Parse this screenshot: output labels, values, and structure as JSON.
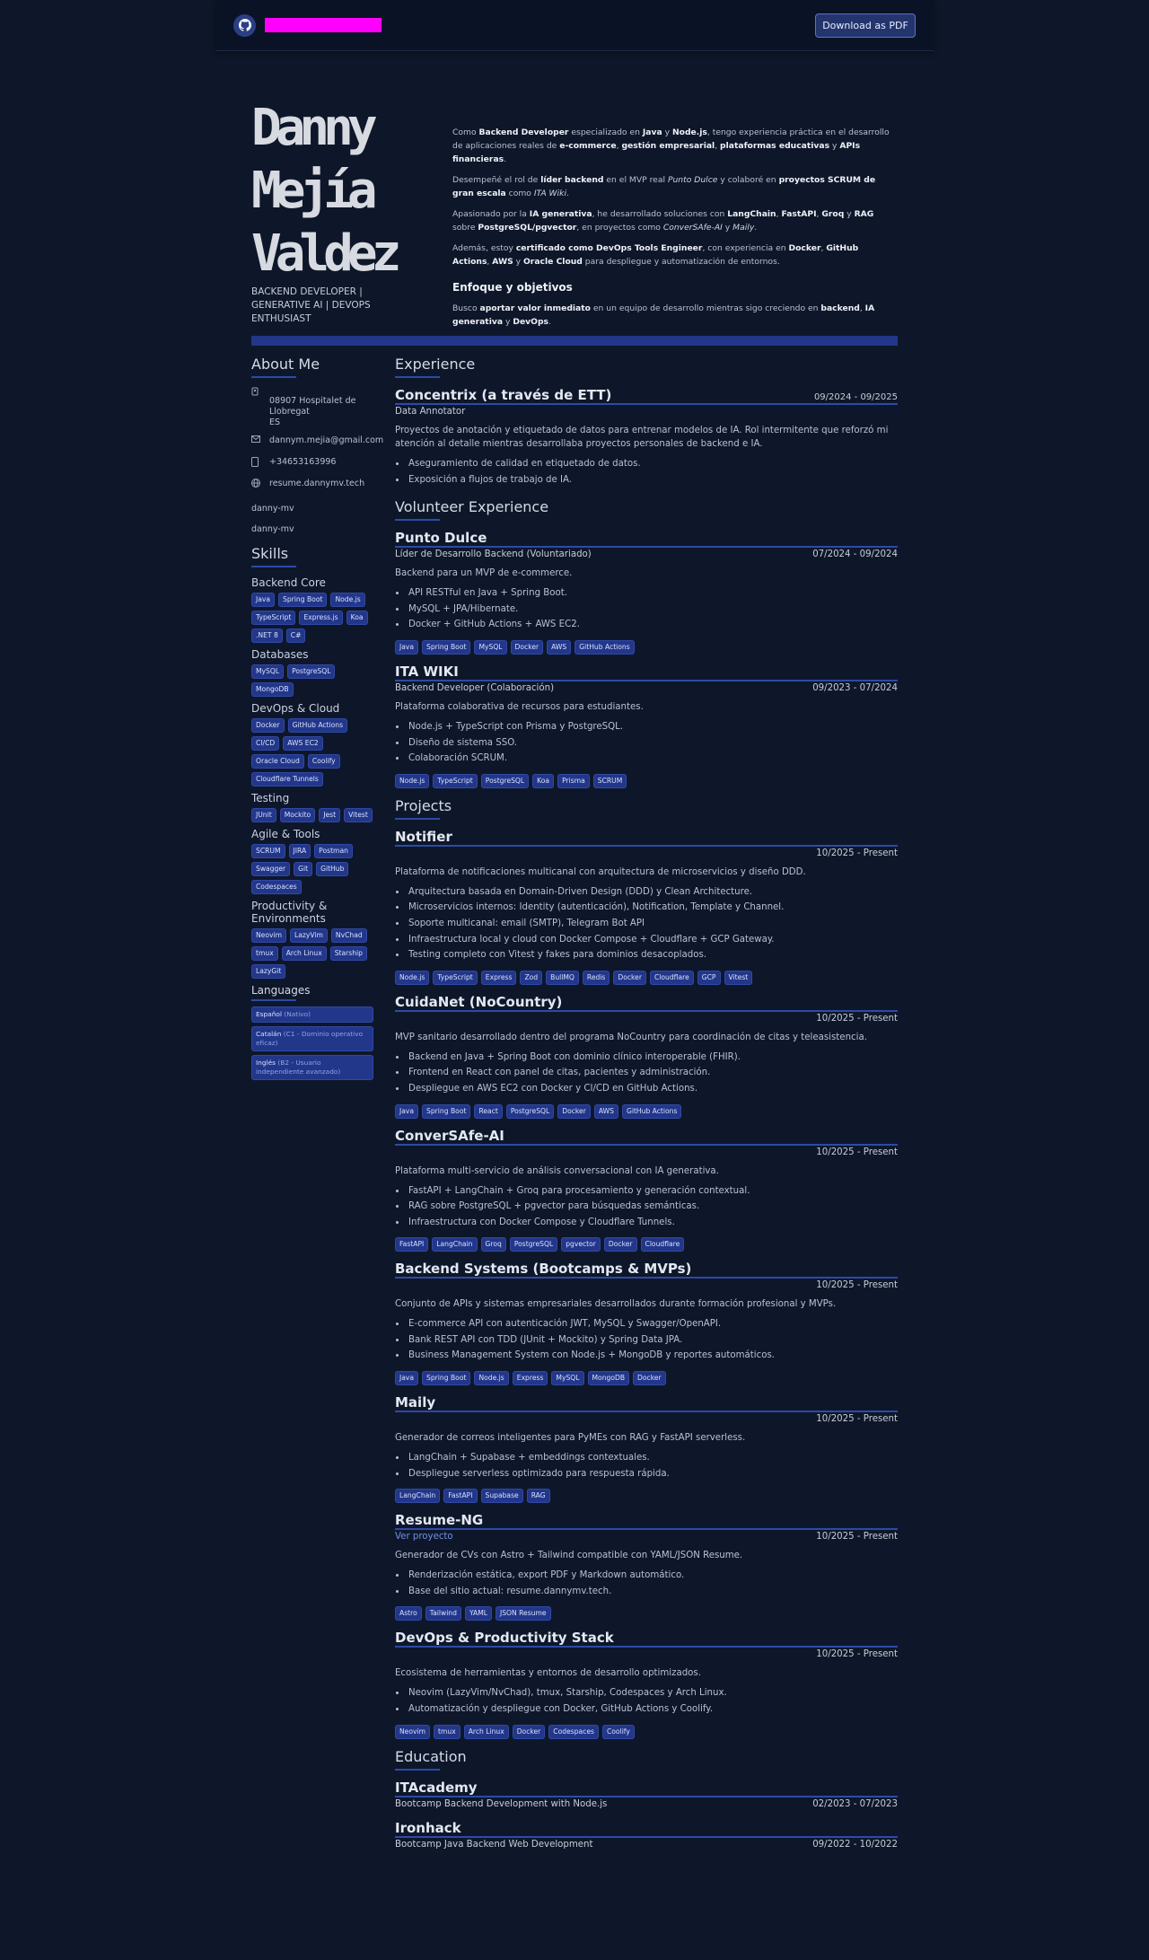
{
  "topbar": {
    "github_icon": "github-icon",
    "download_label": "Download as PDF"
  },
  "header": {
    "name_lines": [
      "Danny",
      "Mejía",
      "Valdez"
    ],
    "roles": "BACKEND DEVELOPER | GENERATIVE AI | DEVOPS ENTHUSIAST"
  },
  "summary": {
    "goal_heading": "Enfoque y objetivos"
  },
  "sidebar": {
    "about_heading": "About Me",
    "address_l1": "08907 Hospitalet de Llobregat",
    "address_l2": "ES",
    "email": "dannym.mejia@gmail.com",
    "phone": "+34653163996",
    "website": "resume.dannymv.tech",
    "profile1": "danny-mv",
    "profile2": "danny-mv",
    "skills_heading": "Skills",
    "skills": [
      {
        "title": "Backend Core",
        "items": [
          "Java",
          "Spring Boot",
          "Node.js",
          "TypeScript",
          "Express.js",
          "Koa",
          ".NET 8",
          "C#"
        ]
      },
      {
        "title": "Databases",
        "items": [
          "MySQL",
          "PostgreSQL",
          "MongoDB"
        ]
      },
      {
        "title": "DevOps & Cloud",
        "items": [
          "Docker",
          "GitHub Actions",
          "CI/CD",
          "AWS EC2",
          "Oracle Cloud",
          "Coolify",
          "Cloudflare Tunnels"
        ]
      },
      {
        "title": "Testing",
        "items": [
          "JUnit",
          "Mockito",
          "Jest",
          "Vitest"
        ]
      },
      {
        "title": "Agile & Tools",
        "items": [
          "SCRUM",
          "JIRA",
          "Postman",
          "Swagger",
          "Git",
          "GitHub",
          "Codespaces"
        ]
      },
      {
        "title": "Productivity & Environments",
        "items": [
          "Neovim",
          "LazyVim",
          "NvChad",
          "tmux",
          "Arch Linux",
          "Starship",
          "LazyGit"
        ]
      }
    ],
    "languages_heading": "Languages",
    "languages": [
      {
        "name": "Español",
        "level": "(Nativo)"
      },
      {
        "name": "Catalán",
        "level": "(C1 - Dominio operativo eficaz)"
      },
      {
        "name": "Inglés",
        "level": "(B2 - Usuario independiente avanzado)"
      }
    ]
  },
  "experience": {
    "heading": "Experience",
    "items": [
      {
        "title": "Concentrix (a través de ETT)",
        "date": "09/2024 - 09/2025",
        "role": "Data Annotator",
        "desc": "Proyectos de anotación y etiquetado de datos para entrenar modelos de IA. Rol intermitente que reforzó mi atención al detalle mientras desarrollaba proyectos personales de backend e IA.",
        "bullets": [
          "Aseguramiento de calidad en etiquetado de datos.",
          "Exposición a flujos de trabajo de IA."
        ]
      }
    ]
  },
  "volunteer": {
    "heading": "Volunteer Experience",
    "items": [
      {
        "title": "Punto Dulce",
        "role": "Líder de Desarrollo Backend (Voluntariado)",
        "date": "07/2024 - 09/2024",
        "desc": "Backend para un MVP de e-commerce.",
        "bullets": [
          "API RESTful en Java + Spring Boot.",
          "MySQL + JPA/Hibernate.",
          "Docker + GitHub Actions + AWS EC2."
        ],
        "tags": [
          "Java",
          "Spring Boot",
          "MySQL",
          "Docker",
          "AWS",
          "GitHub Actions"
        ]
      },
      {
        "title": "ITA WIKI",
        "role": "Backend Developer (Colaboración)",
        "date": "09/2023 - 07/2024",
        "desc": "Plataforma colaborativa de recursos para estudiantes.",
        "bullets": [
          "Node.js + TypeScript con Prisma y PostgreSQL.",
          "Diseño de sistema SSO.",
          "Colaboración SCRUM."
        ],
        "tags": [
          "Node.js",
          "TypeScript",
          "PostgreSQL",
          "Koa",
          "Prisma",
          "SCRUM"
        ]
      }
    ]
  },
  "projects": {
    "heading": "Projects",
    "items": [
      {
        "title": "Notifier",
        "link": "",
        "date": "10/2025 - Present",
        "desc": "Plataforma de notificaciones multicanal con arquitectura de microservicios y diseño DDD.",
        "bullets": [
          "Arquitectura basada en Domain-Driven Design (DDD) y Clean Architecture.",
          "Microservicios internos: Identity (autenticación), Notification, Template y Channel.",
          "Soporte multicanal: email (SMTP), Telegram Bot API",
          "Infraestructura local y cloud con Docker Compose + Cloudflare + GCP Gateway.",
          "Testing completo con Vitest y fakes para dominios desacoplados."
        ],
        "tags": [
          "Node.js",
          "TypeScript",
          "Express",
          "Zod",
          "BullMQ",
          "Redis",
          "Docker",
          "Cloudflare",
          "GCP",
          "Vitest"
        ]
      },
      {
        "title": "CuidaNet (NoCountry)",
        "link": "",
        "date": "10/2025 - Present",
        "desc": "MVP sanitario desarrollado dentro del programa NoCountry para coordinación de citas y teleasistencia.",
        "bullets": [
          "Backend en Java + Spring Boot con dominio clínico interoperable (FHIR).",
          "Frontend en React con panel de citas, pacientes y administración.",
          "Despliegue en AWS EC2 con Docker y CI/CD en GitHub Actions."
        ],
        "tags": [
          "Java",
          "Spring Boot",
          "React",
          "PostgreSQL",
          "Docker",
          "AWS",
          "GitHub Actions"
        ]
      },
      {
        "title": "ConverSAfe-AI",
        "link": "",
        "date": "10/2025 - Present",
        "desc": "Plataforma multi-servicio de análisis conversacional con IA generativa.",
        "bullets": [
          "FastAPI + LangChain + Groq para procesamiento y generación contextual.",
          "RAG sobre PostgreSQL + pgvector para búsquedas semánticas.",
          "Infraestructura con Docker Compose y Cloudflare Tunnels."
        ],
        "tags": [
          "FastAPI",
          "LangChain",
          "Groq",
          "PostgreSQL",
          "pgvector",
          "Docker",
          "Cloudflare"
        ]
      },
      {
        "title": "Backend Systems (Bootcamps & MVPs)",
        "link": "",
        "date": "10/2025 - Present",
        "desc": "Conjunto de APIs y sistemas empresariales desarrollados durante formación profesional y MVPs.",
        "bullets": [
          "E-commerce API con autenticación JWT, MySQL y Swagger/OpenAPI.",
          "Bank REST API con TDD (JUnit + Mockito) y Spring Data JPA.",
          "Business Management System con Node.js + MongoDB y reportes automáticos."
        ],
        "tags": [
          "Java",
          "Spring Boot",
          "Node.js",
          "Express",
          "MySQL",
          "MongoDB",
          "Docker"
        ]
      },
      {
        "title": "Maily",
        "link": "",
        "date": "10/2025 - Present",
        "desc": "Generador de correos inteligentes para PyMEs con RAG y FastAPI serverless.",
        "bullets": [
          "LangChain + Supabase + embeddings contextuales.",
          "Despliegue serverless optimizado para respuesta rápida."
        ],
        "tags": [
          "LangChain",
          "FastAPI",
          "Supabase",
          "RAG"
        ]
      },
      {
        "title": "Resume-NG",
        "link": "Ver proyecto",
        "date": "10/2025 - Present",
        "desc": "Generador de CVs con Astro + Tailwind compatible con YAML/JSON Resume.",
        "bullets": [
          "Renderización estática, export PDF y Markdown automático.",
          "Base del sitio actual: resume.dannymv.tech."
        ],
        "tags": [
          "Astro",
          "Tailwind",
          "YAML",
          "JSON Resume"
        ]
      },
      {
        "title": "DevOps & Productivity Stack",
        "link": "",
        "date": "10/2025 - Present",
        "desc": "Ecosistema de herramientas y entornos de desarrollo optimizados.",
        "bullets": [
          "Neovim (LazyVim/NvChad), tmux, Starship, Codespaces y Arch Linux.",
          "Automatización y despliegue con Docker, GitHub Actions y Coolify."
        ],
        "tags": [
          "Neovim",
          "tmux",
          "Arch Linux",
          "Docker",
          "Codespaces",
          "Coolify"
        ]
      }
    ]
  },
  "education": {
    "heading": "Education",
    "items": [
      {
        "title": "ITAcademy",
        "study": "Bootcamp Backend Development with Node.js",
        "date": "02/2023 - 07/2023"
      },
      {
        "title": "Ironhack",
        "study": "Bootcamp Java Backend Web Development",
        "date": "09/2022 - 10/2022"
      }
    ]
  },
  "colors": {
    "background": "#0e1729",
    "accent": "#22378a",
    "tag": "#22378a",
    "logo": "#ff00ff"
  }
}
